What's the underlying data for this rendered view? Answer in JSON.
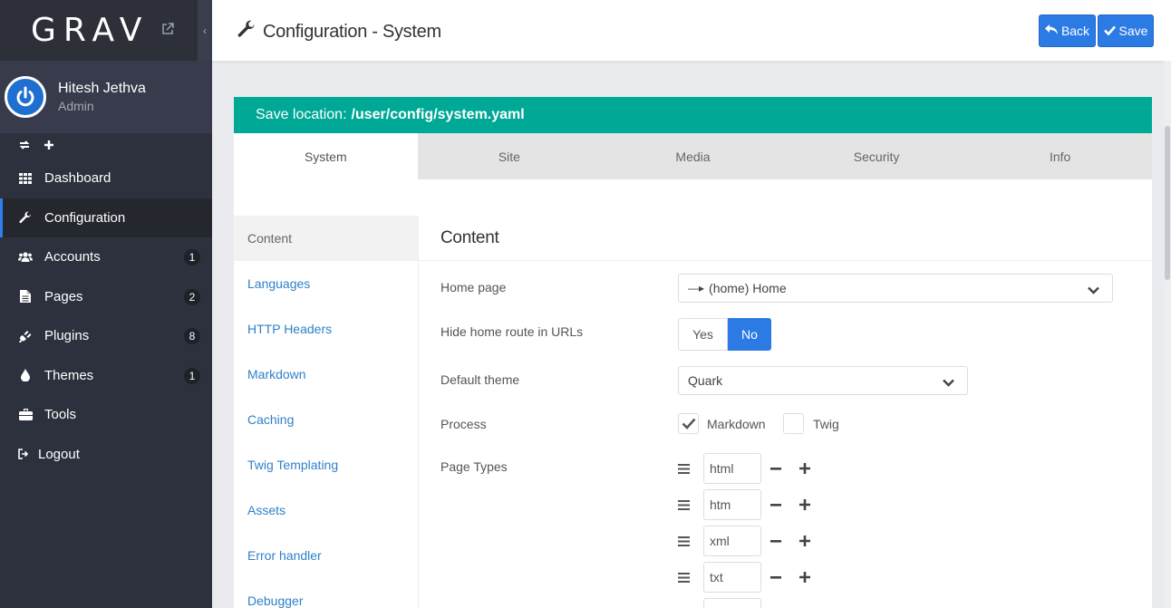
{
  "app": {
    "logo": "GRAV"
  },
  "user": {
    "name": "Hitesh Jethva",
    "role": "Admin"
  },
  "sidebar": {
    "items": [
      {
        "label": "Dashboard"
      },
      {
        "label": "Configuration"
      },
      {
        "label": "Accounts",
        "badge": "1"
      },
      {
        "label": "Pages",
        "badge": "2"
      },
      {
        "label": "Plugins",
        "badge": "8"
      },
      {
        "label": "Themes",
        "badge": "1"
      },
      {
        "label": "Tools"
      },
      {
        "label": "Logout"
      }
    ]
  },
  "header": {
    "title": "Configuration - System",
    "back_label": "Back",
    "save_label": "Save"
  },
  "save_location": {
    "prefix": "Save location:",
    "path": "/user/config/system.yaml"
  },
  "tabs": [
    "System",
    "Site",
    "Media",
    "Security",
    "Info"
  ],
  "subnav": [
    "Content",
    "Languages",
    "HTTP Headers",
    "Markdown",
    "Caching",
    "Twig Templating",
    "Assets",
    "Error handler",
    "Debugger"
  ],
  "content": {
    "title": "Content",
    "home_page": {
      "label": "Home page",
      "value": "(home) Home",
      "prefix": "—▸"
    },
    "hide_home": {
      "label": "Hide home route in URLs",
      "yes": "Yes",
      "no": "No",
      "selected": "No"
    },
    "default_theme": {
      "label": "Default theme",
      "value": "Quark"
    },
    "process": {
      "label": "Process",
      "markdown": "Markdown",
      "twig": "Twig",
      "markdown_checked": true,
      "twig_checked": false
    },
    "page_types": {
      "label": "Page Types",
      "values": [
        "html",
        "htm",
        "xml",
        "txt"
      ]
    }
  },
  "colors": {
    "accent": "#2c7be5",
    "teal": "#00a896",
    "sidebar": "#2d303d"
  }
}
